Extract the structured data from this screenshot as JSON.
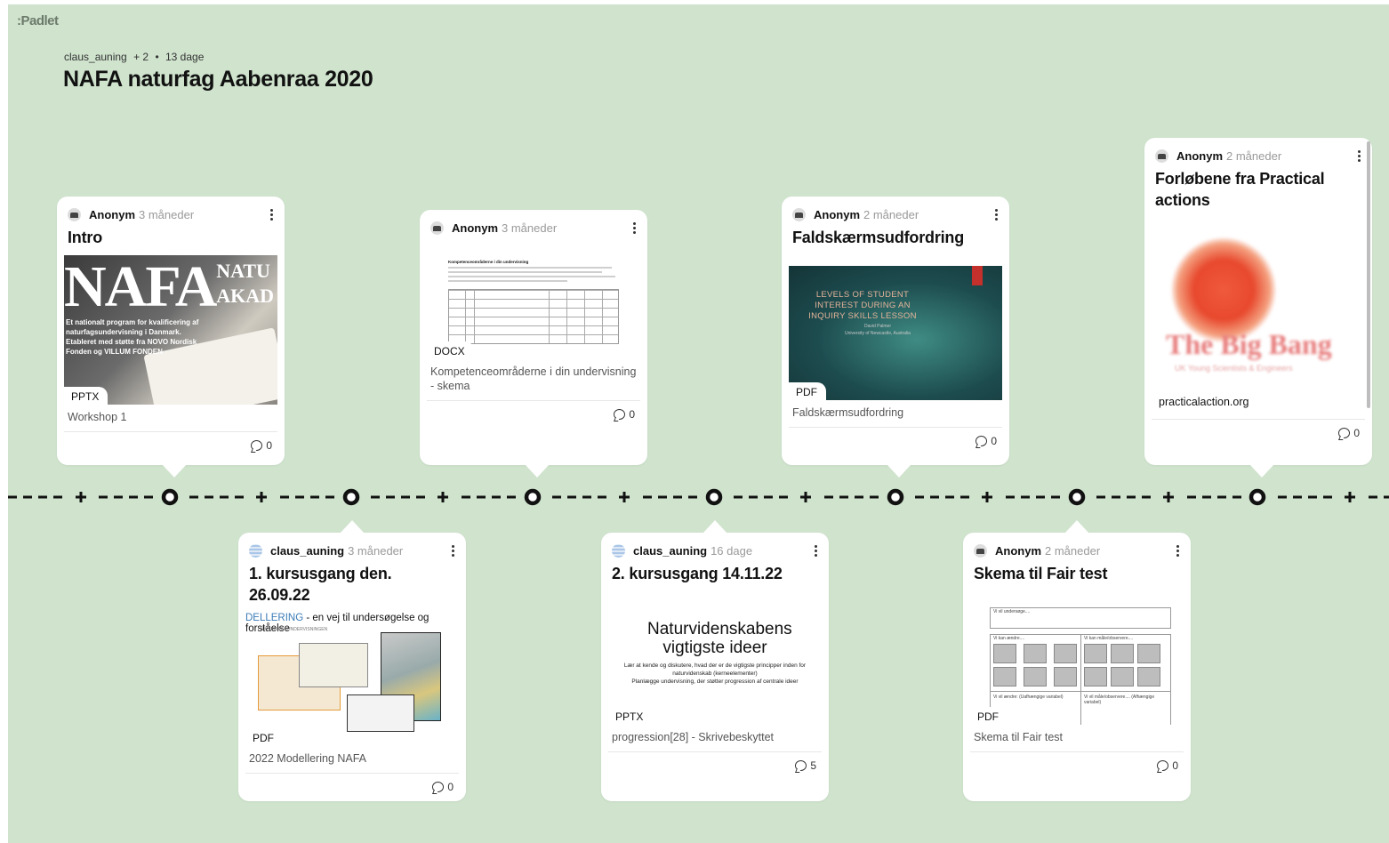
{
  "app": {
    "logo": ":Padlet"
  },
  "header": {
    "owner": "claus_auning",
    "collaborators": "+ 2",
    "age": "13 dage",
    "title": "NAFA naturfag Aabenraa 2020"
  },
  "posts_top": [
    {
      "author": "Anonym",
      "ago": "3 måneder",
      "title": "Intro",
      "attachment_type": "PPTX",
      "caption": "Workshop 1",
      "comments": "0",
      "thumb": {
        "big": "NAFA",
        "side_1": "NATU",
        "side_2": "AKAD",
        "text": "Et nationalt program for kvalificering af naturfagsundervisning i Danmark. Etableret med støtte fra NOVO Nordisk Fonden og VILLUM FONDEN"
      }
    },
    {
      "author": "Anonym",
      "ago": "3 måneder",
      "title": "",
      "attachment_type": "DOCX",
      "caption": "Kompetenceområderne i din undervisning - skema",
      "comments": "0",
      "thumb": {
        "heading": "Kompetenceområderne i din undervisning"
      }
    },
    {
      "author": "Anonym",
      "ago": "2 måneder",
      "title": "Faldskærmsudfordring",
      "attachment_type": "PDF",
      "caption": "Faldskærmsudfordring",
      "comments": "0",
      "thumb": {
        "heading": "LEVELS OF STUDENT INTEREST DURING AN INQUIRY SKILLS LESSON",
        "sub": "David Palmer\nUniversity of Newcastle, Australia"
      }
    },
    {
      "author": "Anonym",
      "ago": "2 måneder",
      "title": "Forløbene fra Practical actions",
      "attachment_type": "practicalaction.org",
      "caption": "",
      "comments": "0",
      "thumb": {
        "brand": "The Big Bang",
        "brand_sub": "UK Young Scientists & Engineers"
      }
    }
  ],
  "posts_bottom": [
    {
      "author": "claus_auning",
      "ago": "3 måneder",
      "title": "1. kursusgang den. 26.09.22",
      "attachment_type": "PDF",
      "caption": "2022 Modellering NAFA",
      "comments": "0",
      "thumb": {
        "head_1": "DELLERING",
        "head_2": " - en vej til undersøgelse og forståelse",
        "sub": "I NATURFAGSUNDERVISNINGEN"
      }
    },
    {
      "author": "claus_auning",
      "ago": "16 dage",
      "title": "2. kursusgang 14.11.22",
      "attachment_type": "PPTX",
      "caption": "progression[28] - Skrivebeskyttet",
      "comments": "5",
      "thumb": {
        "heading": "Naturvidenskabens vigtigste ideer",
        "line_1": "Lær at kende og diskutere, hvad der er de vigtigste principper inden for naturvidenskab (kerneelementer)",
        "line_2": "Planlægge undervisning, der støtter progression af centrale ideer"
      }
    },
    {
      "author": "Anonym",
      "ago": "2 måneder",
      "title": "Skema til Fair test",
      "attachment_type": "PDF",
      "caption": "Skema til Fair test",
      "comments": "0",
      "thumb": {
        "l1": "Vi vil undersøge....",
        "l2": "Vi kan ændre....",
        "l3": "Vi kan måle/observere....",
        "l4": "Vi vil ændre: (Uafhængige variabel)",
        "l5": "Vi vil måle/observere.... (Afhængige variabel)"
      }
    }
  ],
  "colors": {
    "background": "#cfe3cd",
    "card": "#ffffff",
    "timeline": "#111111"
  },
  "icons": {
    "comment": "comment-bubble-icon",
    "more": "kebab-icon",
    "add": "plus-icon",
    "node": "timeline-node-icon"
  }
}
